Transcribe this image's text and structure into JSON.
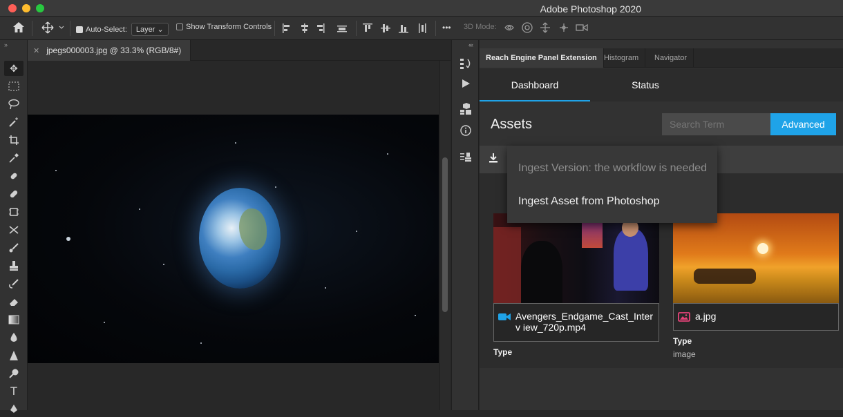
{
  "window": {
    "title": "Adobe Photoshop 2020"
  },
  "options_bar": {
    "auto_select_label": "Auto-Select:",
    "auto_select_checked": true,
    "layer_select_value": "Layer",
    "show_transform_label": "Show Transform Controls",
    "more_label": "•••",
    "mode_3d_label": "3D Mode:"
  },
  "document": {
    "tab_title": "jpegs000003.jpg @ 33.3% (RGB/8#)"
  },
  "panel": {
    "tabs": [
      {
        "label": "Reach Engine Panel Extension",
        "active": true
      },
      {
        "label": "Histogram",
        "active": false
      },
      {
        "label": "Navigator",
        "active": false
      }
    ],
    "nav_tabs": [
      {
        "label": "Dashboard",
        "active": true
      },
      {
        "label": "Status",
        "active": false
      }
    ],
    "assets_title": "Assets",
    "search_placeholder": "Search Term",
    "advanced_label": "Advanced",
    "dropdown": {
      "items": [
        {
          "label": "Ingest Version: the workflow is needed",
          "disabled": true
        },
        {
          "label": "Ingest Asset from Photoshop",
          "disabled": false
        }
      ]
    },
    "assets": [
      {
        "name": "Avengers_Endgame_Cast_Interv iew_720p.mp4",
        "kind": "video",
        "type_label": "Type",
        "type_value": ""
      },
      {
        "name": "a.jpg",
        "kind": "image",
        "type_label": "Type",
        "type_value": "image"
      }
    ]
  },
  "colors": {
    "accent": "#1fa3e8",
    "image_icon": "#e8437a"
  }
}
